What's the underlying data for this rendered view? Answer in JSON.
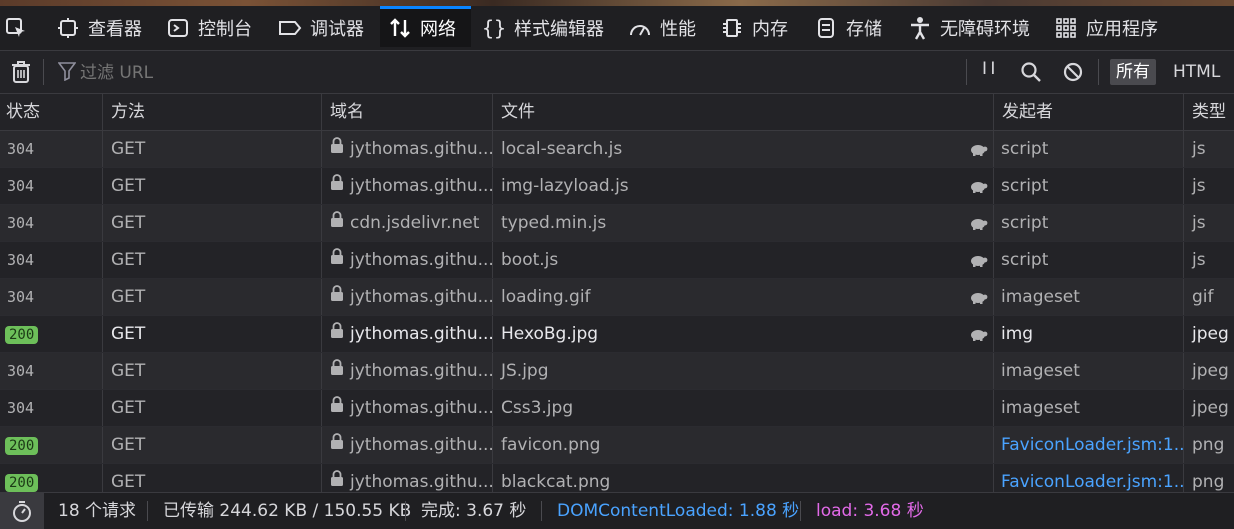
{
  "tabs": [
    {
      "label": "",
      "icon": "element-picker-icon"
    },
    {
      "label": "查看器",
      "icon": "inspector-icon"
    },
    {
      "label": "控制台",
      "icon": "console-icon"
    },
    {
      "label": "调试器",
      "icon": "debugger-icon"
    },
    {
      "label": "网络",
      "icon": "network-icon",
      "active": true
    },
    {
      "label": "样式编辑器",
      "icon": "style-editor-icon"
    },
    {
      "label": "性能",
      "icon": "performance-icon"
    },
    {
      "label": "内存",
      "icon": "memory-icon"
    },
    {
      "label": "存储",
      "icon": "storage-icon"
    },
    {
      "label": "无障碍环境",
      "icon": "accessibility-icon"
    },
    {
      "label": "应用程序",
      "icon": "application-icon"
    }
  ],
  "toolbar": {
    "filter_placeholder": "过滤 URL",
    "pause_label": "I I",
    "all_label": "所有",
    "html_label": "HTML"
  },
  "columns": {
    "status": "状态",
    "method": "方法",
    "domain": "域名",
    "file": "文件",
    "initiator": "发起者",
    "type": "类型"
  },
  "rows": [
    {
      "status": "304",
      "method": "GET",
      "domain": "jythomas.githu...",
      "file": "local-search.js",
      "initiator": "script",
      "type": "js",
      "throttle": true
    },
    {
      "status": "304",
      "method": "GET",
      "domain": "jythomas.githu...",
      "file": "img-lazyload.js",
      "initiator": "script",
      "type": "js",
      "throttle": true
    },
    {
      "status": "304",
      "method": "GET",
      "domain": "cdn.jsdelivr.net",
      "file": "typed.min.js",
      "initiator": "script",
      "type": "js",
      "throttle": true
    },
    {
      "status": "304",
      "method": "GET",
      "domain": "jythomas.githu...",
      "file": "boot.js",
      "initiator": "script",
      "type": "js",
      "throttle": true
    },
    {
      "status": "304",
      "method": "GET",
      "domain": "jythomas.githu...",
      "file": "loading.gif",
      "initiator": "imageset",
      "type": "gif",
      "throttle": true
    },
    {
      "status": "200",
      "method": "GET",
      "domain": "jythomas.githu...",
      "file": "HexoBg.jpg",
      "initiator": "img",
      "type": "jpeg",
      "throttle": true
    },
    {
      "status": "304",
      "method": "GET",
      "domain": "jythomas.githu...",
      "file": "JS.jpg",
      "initiator": "imageset",
      "type": "jpeg",
      "throttle": false
    },
    {
      "status": "304",
      "method": "GET",
      "domain": "jythomas.githu...",
      "file": "Css3.jpg",
      "initiator": "imageset",
      "type": "jpeg",
      "throttle": false
    },
    {
      "status": "200",
      "method": "GET",
      "domain": "jythomas.githu...",
      "file": "favicon.png",
      "initiator": "FaviconLoader.jsm:1...",
      "type": "png",
      "throttle": false,
      "initiator_link": true
    },
    {
      "status": "200",
      "method": "GET",
      "domain": "jythomas.githu...",
      "file": "blackcat.png",
      "initiator": "FaviconLoader.jsm:1...",
      "type": "png",
      "throttle": false,
      "initiator_link": true
    }
  ],
  "statusbar": {
    "requests": "18 个请求",
    "transferred": "已传输 244.62 KB / 150.55 KB",
    "finish": "完成: 3.67 秒",
    "dcl": "DOMContentLoaded: 1.88 秒",
    "load": "load: 3.68 秒"
  },
  "colors": {
    "accent": "#0a84ff",
    "badge_200": "#6dbf5a",
    "dcl": "#4aa3ff",
    "load": "#e26ae8",
    "link": "#4aa3ff"
  }
}
